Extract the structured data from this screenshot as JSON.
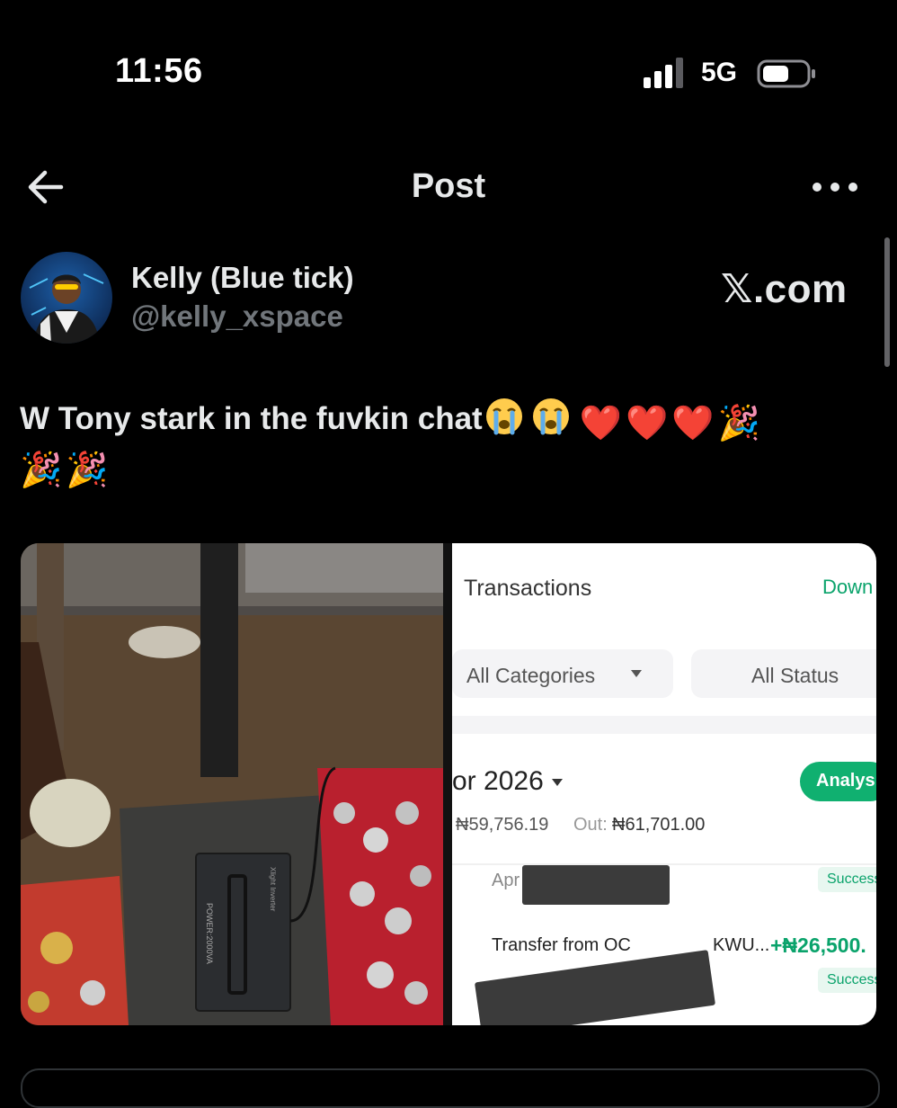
{
  "status_bar": {
    "time": "11:56",
    "network": "5G"
  },
  "nav": {
    "title": "Post"
  },
  "author": {
    "display_name": "Kelly (Blue tick)",
    "handle": "@kelly_xspace",
    "brand": "𝕏.com"
  },
  "tweet": {
    "text": "W Tony stark in the fuvkin chat",
    "emojis": [
      "sob-icon",
      "sob-icon",
      "heart-icon",
      "heart-icon",
      "heart-icon",
      "party-popper-icon",
      "party-popper-icon",
      "party-popper-icon"
    ],
    "heart_glyph": "❤️",
    "party_glyph": "🎉"
  },
  "media": {
    "photo": {
      "label": "POWER:2000VA",
      "maker_label": "Xlight Inverter"
    },
    "screenshot": {
      "header": "Transactions",
      "download_label": "Down",
      "category_filter": "All Categories",
      "status_filter": "All Status",
      "month": "or 2026",
      "analysis_label": "Analysi",
      "in_amount": "₦59,756.19",
      "out_label": "Out:",
      "out_amount": "₦61,701.00",
      "row1_date": "Apr",
      "row1_status": "Success",
      "row2_title": "Transfer from OC",
      "row2_title_tail": "KWU...",
      "row2_amount": "+₦26,500.",
      "row2_status": "Success"
    }
  },
  "colors": {
    "accent_green": "#0aa36b",
    "heart": "#e0162b",
    "handle_gray": "#71767b"
  }
}
